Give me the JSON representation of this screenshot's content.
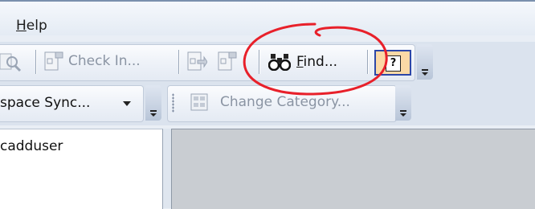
{
  "menubar": {
    "help_label_accel": "H",
    "help_label_rest": "elp"
  },
  "toolbar1": {
    "check_in_label": "Check In...",
    "find_label_accel": "F",
    "find_label_rest": "ind...",
    "help_button_glyph": "?"
  },
  "toolbar2": {
    "workspace_sync_label": "space Sync...",
    "change_category_label": "Change Category..."
  },
  "left_panel": {
    "user_text": "cadduser"
  },
  "colors": {
    "annotation_circle": "#e8202a",
    "help_button_highlight": "#fbd9a6",
    "help_button_border": "#2d47a8"
  },
  "icons": [
    "search-page-icon",
    "check-in-icon",
    "document-icon",
    "document-arrow-icon",
    "binoculars-icon",
    "help-icon",
    "change-category-icon"
  ]
}
